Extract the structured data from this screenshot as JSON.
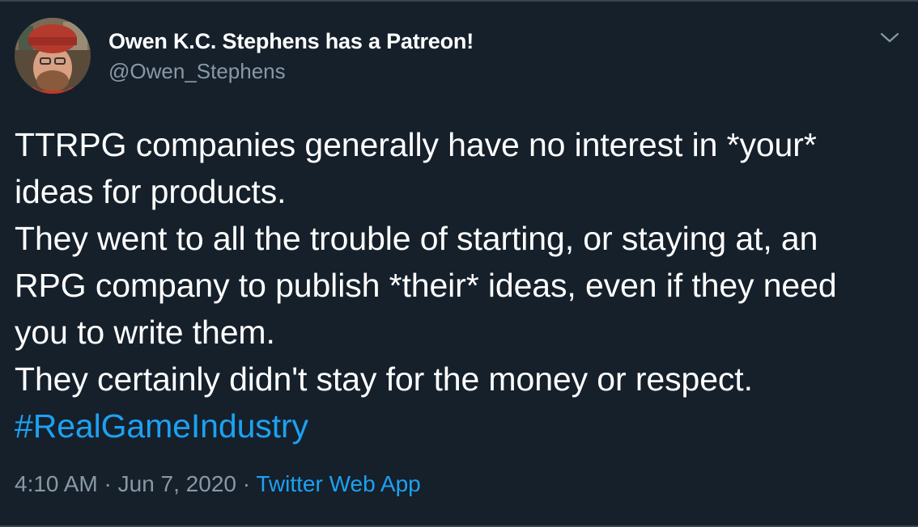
{
  "author": {
    "display_name": "Owen K.C. Stephens has a Patreon!",
    "handle": "@Owen_Stephens",
    "avatar_icon": "profile-photo"
  },
  "tweet": {
    "lines": [
      "TTRPG companies generally have no interest in *your*",
      "ideas for products.",
      "They went to all the trouble of starting, or staying at, an",
      "RPG company to publish *their* ideas, even if they need",
      "you to write them.",
      "They certainly didn't stay for the money or respect."
    ],
    "hashtag": "#RealGameIndustry"
  },
  "meta": {
    "time": "4:10 AM",
    "separator": " · ",
    "date": "Jun 7, 2020",
    "source": "Twitter Web App"
  },
  "menu": {
    "icon": "chevron-down-icon"
  },
  "colors": {
    "background": "#15202b",
    "text": "#ffffff",
    "secondary": "#8899a6",
    "link": "#1da1f2",
    "border": "#38444d"
  }
}
